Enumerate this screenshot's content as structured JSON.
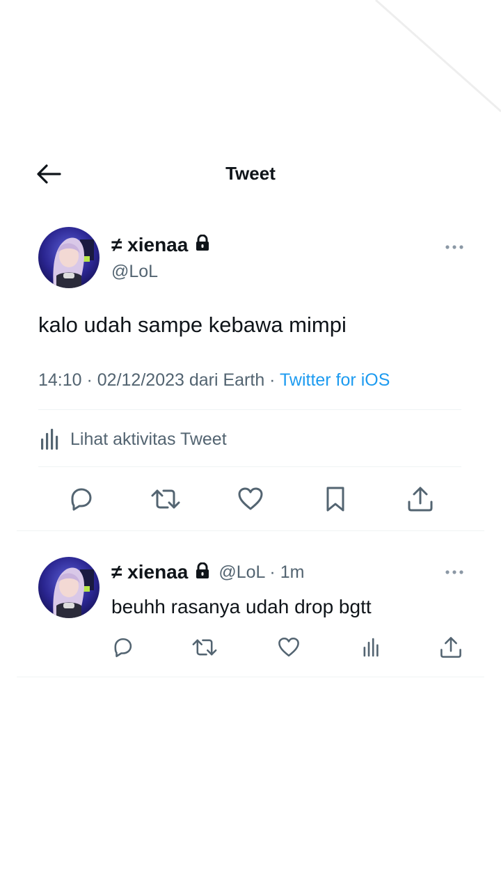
{
  "header": {
    "title": "Tweet"
  },
  "tweet": {
    "name": "≠ xienaa",
    "handle": "@LoL",
    "text": "kalo udah sampe kebawa mimpi",
    "meta_prefix": "14:10 · 02/12/2023 dari Earth ·",
    "source": "Twitter for iOS",
    "activity_label": "Lihat aktivitas Tweet"
  },
  "reply": {
    "name": "≠ xienaa",
    "handle_time": "@LoL · 1m",
    "text": "beuhh rasanya udah drop bgtt"
  },
  "icons": {
    "back": "back-arrow-icon",
    "lock": "lock-icon",
    "more": "more-dots-icon",
    "activity": "analytics-icon",
    "reply": "reply-icon",
    "retweet": "retweet-icon",
    "like": "heart-icon",
    "bookmark": "bookmark-icon",
    "share": "share-icon",
    "views": "views-icon"
  },
  "colors": {
    "text": "#0f1419",
    "secondary": "#536471",
    "link": "#1d9bf0",
    "divider": "#eff3f4"
  }
}
